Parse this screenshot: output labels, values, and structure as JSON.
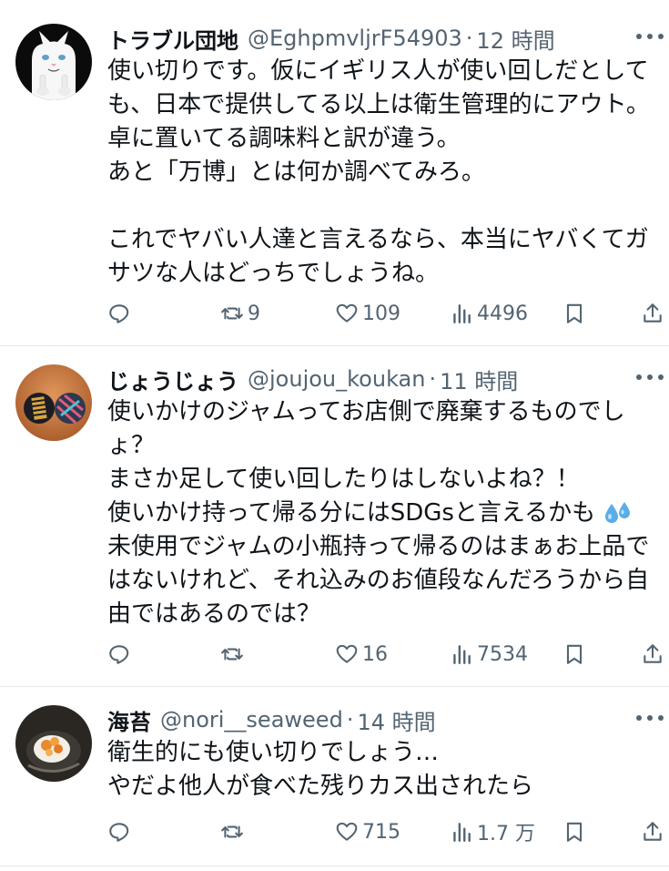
{
  "tweets": [
    {
      "display_name": "トラブル団地",
      "handle": "@EghpmvljrF54903",
      "time": "12 時間",
      "avatar_icon": "white-cat-middle-finger-avatar",
      "lines": [
        "使い切りです。仮にイギリス人が使い回しだとして",
        "も、日本で提供してる以上は衛生管理的にアウト。",
        "卓に置いてる調味料と訳が違う。",
        "あと「万博」とは何か調べてみろ。",
        "",
        "これでヤバい人達と言えるなら、本当にヤバくてガ",
        "サツな人はどっちでしょうね。"
      ],
      "replies": "",
      "retweets": "9",
      "likes": "109",
      "views": "4496"
    },
    {
      "display_name": "じょうじょう",
      "handle": "@joujou_koukan",
      "time": "11 時間",
      "avatar_icon": "two-buttons-avatar",
      "lines": [
        "使いかけのジャムってお店側で廃棄するものでし",
        "ょ？",
        "まさか足して使い回したりはしないよね？！",
        "使いかけ持って帰る分にはSDGsと言えるかも",
        "未使用でジャムの小瓶持って帰るのはまぁお上品で",
        "はないけれど、それ込みのお値段なんだろうから自",
        "由ではあるのでは？"
      ],
      "replies": "",
      "retweets": "",
      "likes": "16",
      "views": "7534"
    },
    {
      "display_name": "海苔",
      "handle": "@nori__seaweed",
      "time": "14 時間",
      "avatar_icon": "sushi-avatar",
      "lines": [
        "衛生的にも使い切りでしょう…",
        "やだよ他人が食べた残りカス出されたら"
      ],
      "replies": "",
      "retweets": "",
      "likes": "715",
      "views": "1.7 万"
    }
  ],
  "colors": {
    "text": "#0f1419",
    "secondary": "#536471",
    "divider": "#e6e9ec",
    "droplet": "#5aaee8"
  },
  "icons": {
    "reply": "reply-icon",
    "retweet": "retweet-icon",
    "like": "heart-icon",
    "views": "views-bar-chart-icon",
    "bookmark": "bookmark-icon",
    "share": "share-icon",
    "more": "more-dots-icon",
    "emoji": "sweat-droplets-emoji-icon"
  }
}
